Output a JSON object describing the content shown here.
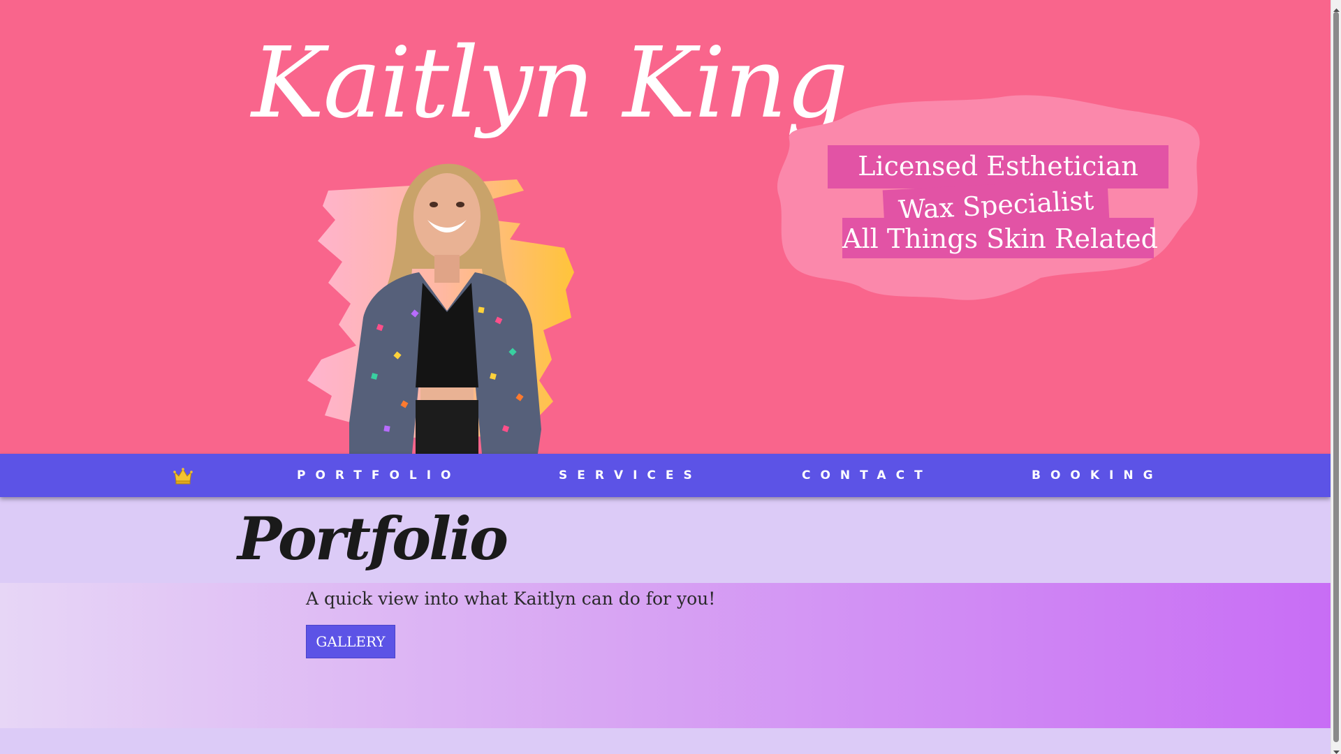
{
  "hero": {
    "title": "Kaitlyn King",
    "taglines": [
      "Licensed Esthetician",
      "Wax Specialist",
      "All Things Skin Related"
    ],
    "background_color": "#f9658c",
    "tag_highlight_color": "#e253a5"
  },
  "nav": {
    "home_icon": "crown-icon",
    "items": [
      {
        "label": "PORTFOLIO"
      },
      {
        "label": "SERVICES"
      },
      {
        "label": "CONTACT"
      },
      {
        "label": "BOOKING"
      }
    ],
    "background_color": "#5c53e6"
  },
  "portfolio": {
    "title": "Portfolio",
    "description": "A quick view into what Kaitlyn can do for you!",
    "button_label": "GALLERY"
  }
}
